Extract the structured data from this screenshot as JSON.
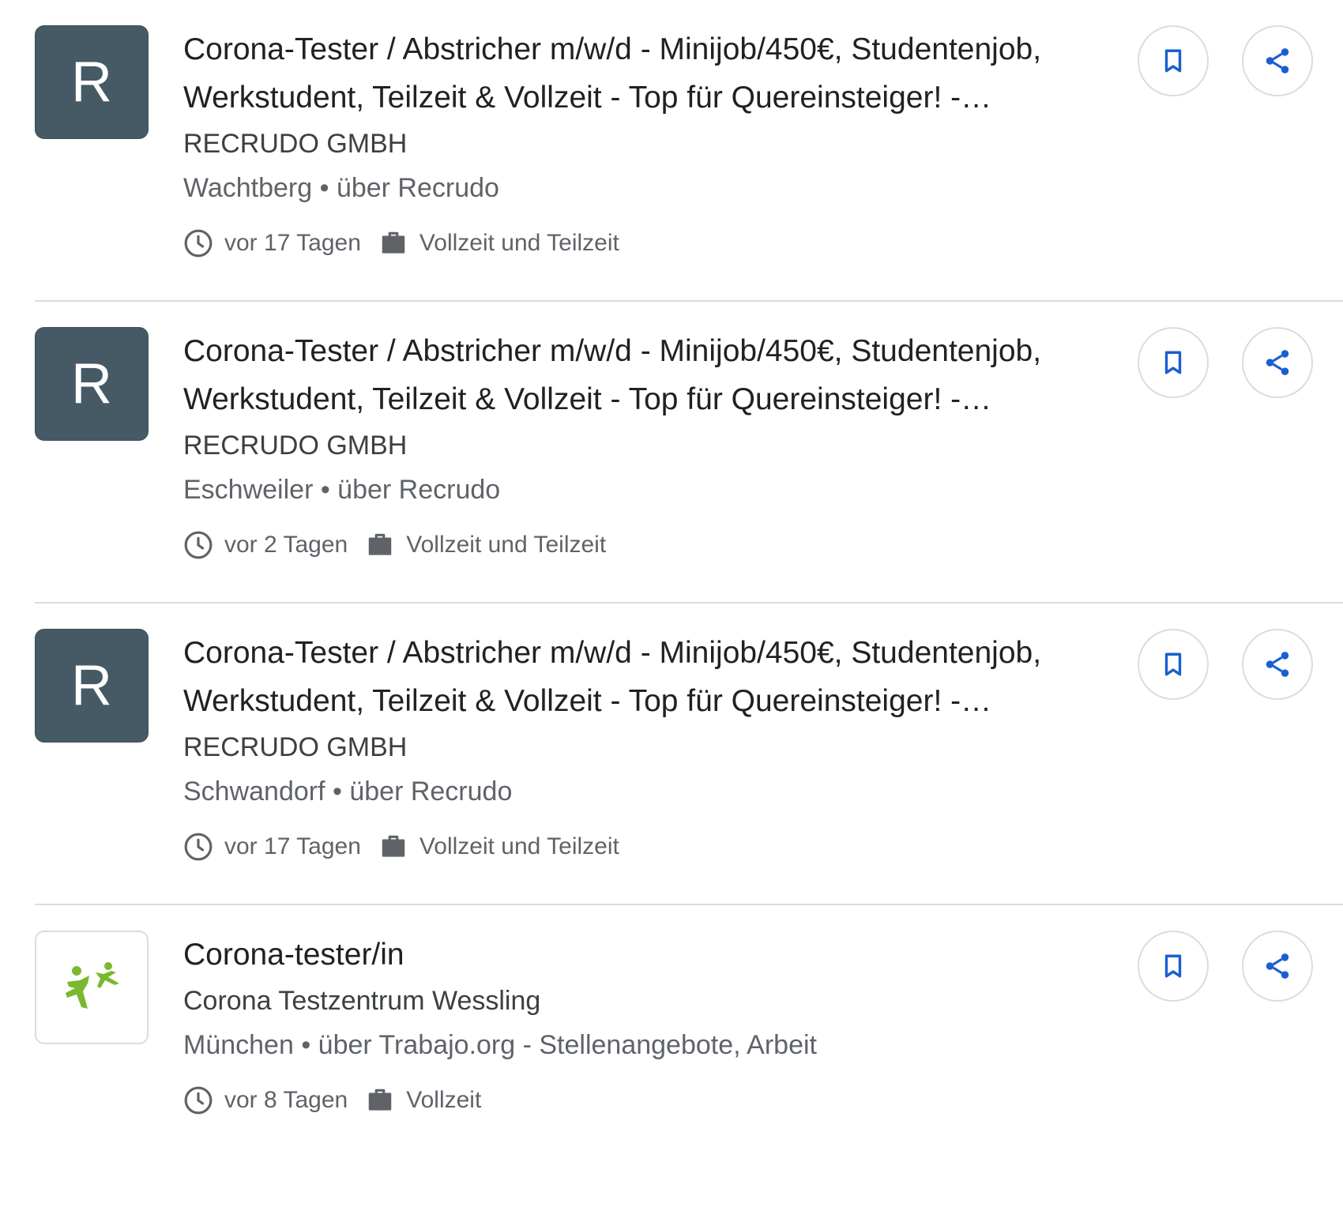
{
  "jobs": [
    {
      "logo_letter": "R",
      "title": "Corona-Tester / Abstricher m/w/d - Minijob/450€, Studentenjob, Werkstudent, Teilzeit & Vollzeit - Top für Quereinsteiger! -…",
      "company": "RECRUDO GMBH",
      "location": "Wachtberg • über Recrudo",
      "posted": "vor 17 Tagen",
      "type": "Vollzeit und Teilzeit"
    },
    {
      "logo_letter": "R",
      "title": "Corona-Tester / Abstricher m/w/d - Minijob/450€, Studentenjob, Werkstudent, Teilzeit & Vollzeit - Top für Quereinsteiger! -…",
      "company": "RECRUDO GMBH",
      "location": "Eschweiler • über Recrudo",
      "posted": "vor 2 Tagen",
      "type": "Vollzeit und Teilzeit"
    },
    {
      "logo_letter": "R",
      "title": "Corona-Tester / Abstricher m/w/d - Minijob/450€, Studentenjob, Werkstudent, Teilzeit & Vollzeit - Top für Quereinsteiger! -…",
      "company": "RECRUDO GMBH",
      "location": "Schwandorf • über Recrudo",
      "posted": "vor 17 Tagen",
      "type": "Vollzeit und Teilzeit"
    },
    {
      "logo_letter": "",
      "title": "Corona-tester/in",
      "company": "Corona Testzentrum Wessling",
      "location": "München • über Trabajo.org - Stellenangebote, Arbeit",
      "posted": "vor 8 Tagen",
      "type": "Vollzeit"
    }
  ],
  "icons": {
    "clock": "clock-icon",
    "briefcase": "briefcase-icon",
    "bookmark": "bookmark-icon",
    "share": "share-icon"
  },
  "colors": {
    "logo_bg": "#455a64",
    "accent": "#1a5fd0",
    "logo_green": "#7cb82f",
    "divider": "#dadce0"
  }
}
